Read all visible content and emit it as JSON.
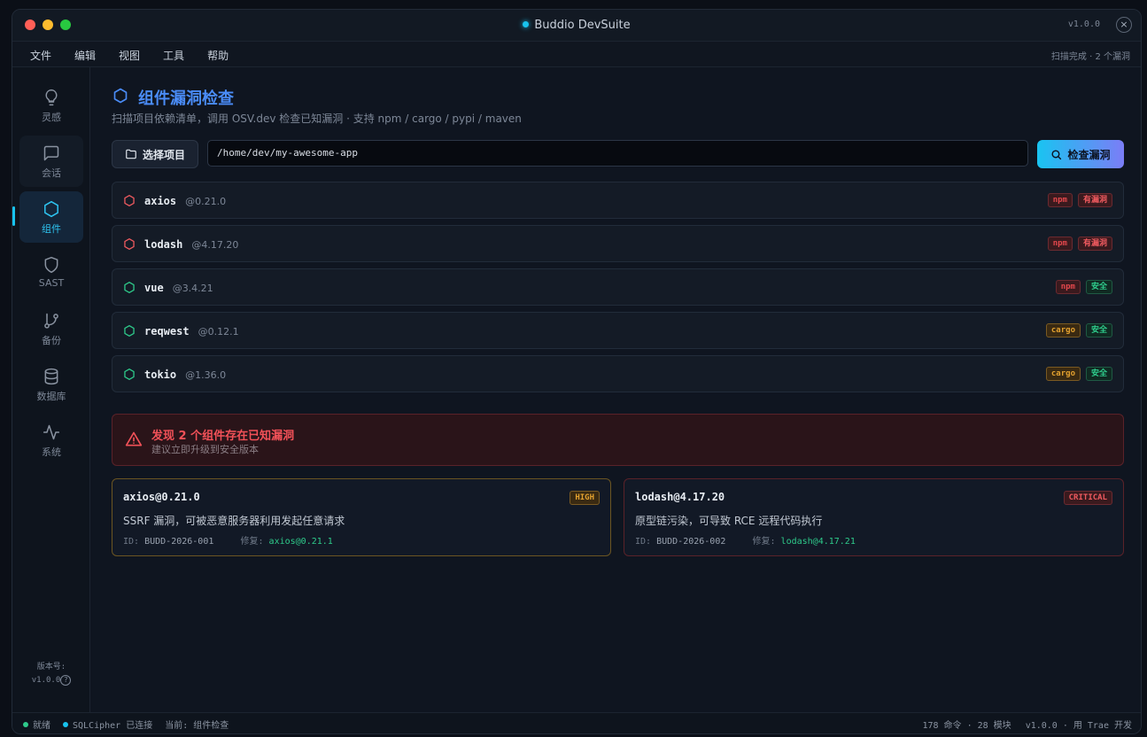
{
  "window": {
    "title": "Buddio DevSuite",
    "version": "v1.0.0",
    "close_glyph": "×"
  },
  "menu": {
    "items": [
      "文件",
      "编辑",
      "视图",
      "工具",
      "帮助"
    ],
    "status": "扫描完成 · 2 个漏洞"
  },
  "sidebar": {
    "items": [
      {
        "label": "灵感",
        "icon": "lightbulb-icon"
      },
      {
        "label": "会话",
        "icon": "chat-icon"
      },
      {
        "label": "组件",
        "icon": "hexagon-icon",
        "active": true
      },
      {
        "label": "SAST",
        "icon": "shield-icon"
      },
      {
        "label": "备份",
        "icon": "branch-icon"
      },
      {
        "label": "数据库",
        "icon": "database-icon"
      },
      {
        "label": "系统",
        "icon": "activity-icon"
      }
    ],
    "version_label": "版本号:",
    "version_value": "v1.0.0",
    "help_glyph": "?"
  },
  "page": {
    "title": "组件漏洞检查",
    "subtitle": "扫描项目依赖清单，调用 OSV.dev 检查已知漏洞 · 支持 npm / cargo / pypi / maven",
    "select_button": "选择项目",
    "path_value": "/home/dev/my-awesome-app",
    "scan_button": "检查漏洞"
  },
  "packages": [
    {
      "name": "axios",
      "version": "@0.21.0",
      "ecosystem": "npm",
      "status": "有漏洞",
      "vulnerable": true
    },
    {
      "name": "lodash",
      "version": "@4.17.20",
      "ecosystem": "npm",
      "status": "有漏洞",
      "vulnerable": true
    },
    {
      "name": "vue",
      "version": "@3.4.21",
      "ecosystem": "npm",
      "status": "安全",
      "vulnerable": false
    },
    {
      "name": "reqwest",
      "version": "@0.12.1",
      "ecosystem": "cargo",
      "status": "安全",
      "vulnerable": false
    },
    {
      "name": "tokio",
      "version": "@1.36.0",
      "ecosystem": "cargo",
      "status": "安全",
      "vulnerable": false
    }
  ],
  "alert": {
    "title": "发现 2 个组件存在已知漏洞",
    "subtitle": "建议立即升级到安全版本"
  },
  "vulns": [
    {
      "title": "axios@0.21.0",
      "severity": "HIGH",
      "desc": "SSRF 漏洞，可被恶意服务器利用发起任意请求",
      "id_label": "ID:",
      "id": "BUDD-2026-001",
      "fix_label": "修复:",
      "fix": "axios@0.21.1"
    },
    {
      "title": "lodash@4.17.20",
      "severity": "CRITICAL",
      "desc": "原型链污染，可导致 RCE 远程代码执行",
      "id_label": "ID:",
      "id": "BUDD-2026-002",
      "fix_label": "修复:",
      "fix": "lodash@4.17.21"
    }
  ],
  "statusbar": {
    "ready": "就绪",
    "db": "SQLCipher 已连接",
    "current": "当前: 组件检查",
    "commands": "178 命令 · 28 模块",
    "credit": "v1.0.0 · 用 Trae 开发"
  },
  "colors": {
    "accent": "#18c3ee",
    "title_blue": "#4a8cf7",
    "danger": "#ef5a5f",
    "warning": "#e3a12f",
    "safe": "#2ecb8b"
  }
}
